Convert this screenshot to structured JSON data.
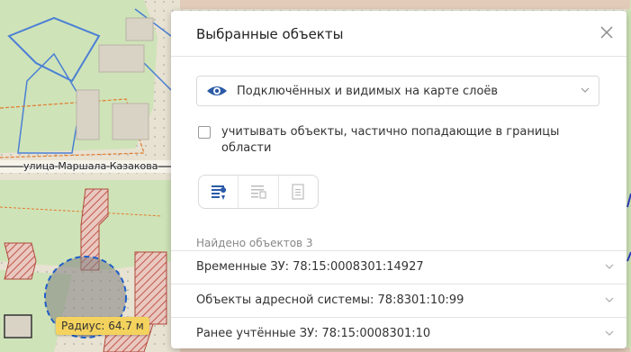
{
  "map": {
    "street_label": "улица Маршала Казакова",
    "radius_label": "Радиус: 64.7 м"
  },
  "panel": {
    "title": "Выбранные объекты",
    "layer_select": {
      "value": "Подключённых и видимых на карте слоёв"
    },
    "partial_checkbox": {
      "label": "учитывать объекты, частично попадающие в границы области",
      "checked": false
    },
    "view_modes": [
      "list-with-marker",
      "list-with-bracket",
      "document"
    ],
    "found_text": "Найдено объектов 3",
    "results": [
      {
        "label": "Временные ЗУ: 78:15:0008301:14927"
      },
      {
        "label": "Объекты адресной системы: 78:8301:10:99"
      },
      {
        "label": "Ранее учтённые ЗУ: 78:15:0008301:10"
      }
    ]
  },
  "colors": {
    "accent": "#2b5aa8",
    "badge": "#f3d25e"
  }
}
